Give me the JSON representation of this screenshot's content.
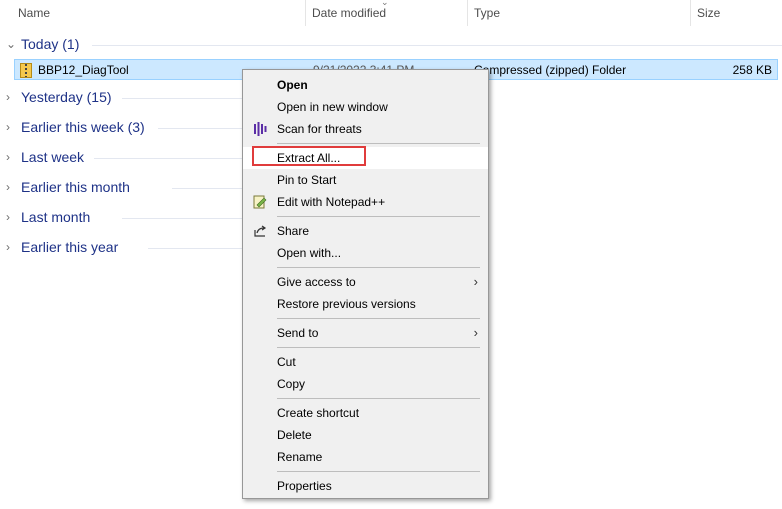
{
  "columns": {
    "name": "Name",
    "date_modified": "Date modified",
    "type": "Type",
    "size": "Size"
  },
  "groups": [
    {
      "label": "Today (1)"
    },
    {
      "label": "Yesterday (15)"
    },
    {
      "label": "Earlier this week (3)"
    },
    {
      "label": "Last week"
    },
    {
      "label": "Earlier this month"
    },
    {
      "label": "Last month"
    },
    {
      "label": "Earlier this year"
    }
  ],
  "file": {
    "name": "BBP12_DiagTool",
    "date": "9/21/2022 3:41 PM",
    "type": "Compressed (zipped) Folder",
    "size": "258 KB"
  },
  "menu": {
    "open": "Open",
    "open_new_window": "Open in new window",
    "scan": "Scan for threats",
    "extract_all": "Extract All...",
    "pin_to_start": "Pin to Start",
    "edit_notepad": "Edit with Notepad++",
    "share": "Share",
    "open_with": "Open with...",
    "give_access": "Give access to",
    "restore_versions": "Restore previous versions",
    "send_to": "Send to",
    "cut": "Cut",
    "copy": "Copy",
    "create_shortcut": "Create shortcut",
    "delete": "Delete",
    "rename": "Rename",
    "properties": "Properties"
  },
  "icons": {
    "scan": "defender-scan-icon",
    "notepad": "notepad-plus-plus-icon",
    "share": "share-icon",
    "zip": "zip-folder-icon"
  },
  "colors": {
    "selection_bg": "#cce8ff",
    "group_text": "#1e3287",
    "highlight_box": "#e03c3c",
    "scan_icon": "#5b2ea6"
  }
}
